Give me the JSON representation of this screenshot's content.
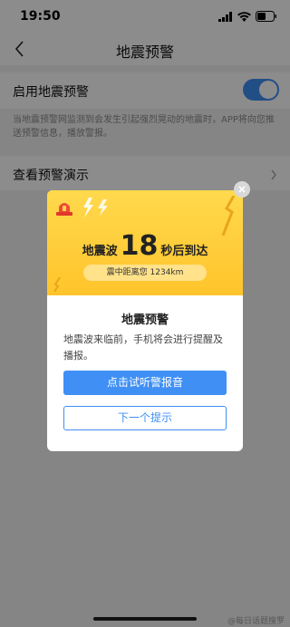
{
  "status_bar": {
    "time": "19:50"
  },
  "nav": {
    "title": "地震预警"
  },
  "settings": {
    "enable_label": "启用地震预警",
    "enabled": true,
    "description": "当地震预警网监测到会发生引起强烈晃动的地震时，APP将向您推送预警信息，播放警报。",
    "demo_label": "查看预警演示"
  },
  "dialog": {
    "countdown_prefix": "地震波",
    "countdown_seconds": "18",
    "countdown_suffix": "秒后到达",
    "distance": "震中距离您 1234km",
    "title": "地震预警",
    "message": "地震波来临前，手机将会进行提醒及播报。",
    "primary_button": "点击试听警报音",
    "secondary_button": "下一个提示"
  },
  "watermark": "@每日话题搜罗",
  "colors": {
    "accent": "#3f8ff5",
    "header_yellow": "#ffc42b"
  },
  "icons": [
    "back-chevron-icon",
    "chevron-right-icon",
    "siren-icon",
    "lightning-icon",
    "close-icon",
    "signal-icon",
    "wifi-icon",
    "battery-icon"
  ]
}
